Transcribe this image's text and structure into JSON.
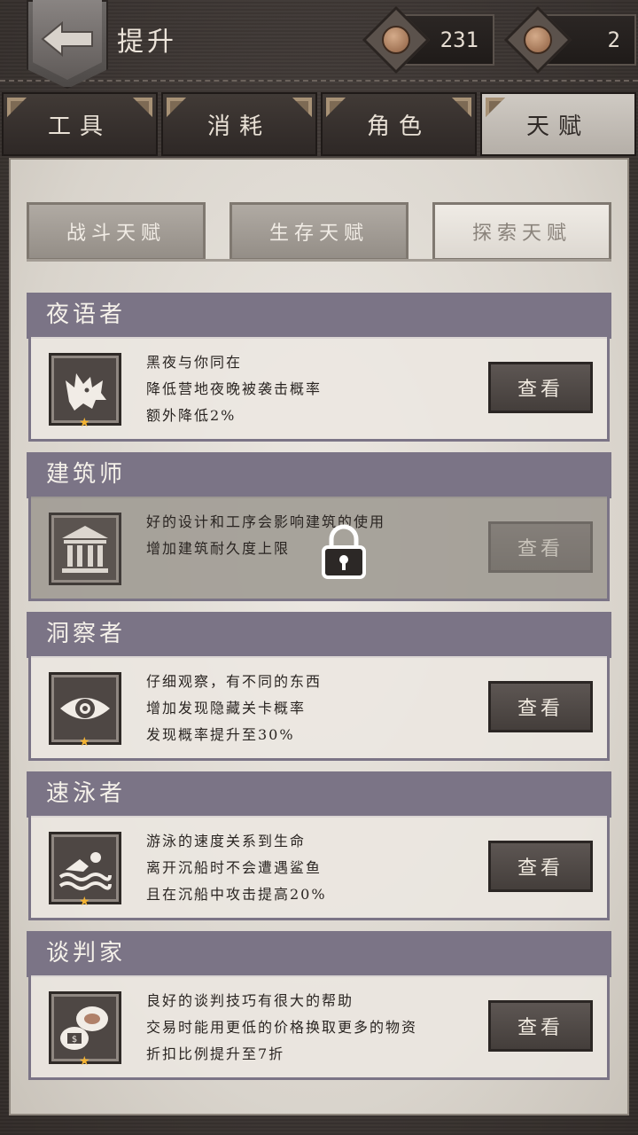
{
  "header": {
    "title": "提升",
    "currency": [
      {
        "icon": "coin-icon",
        "value": "231"
      },
      {
        "icon": "coin-icon",
        "value": "2"
      }
    ]
  },
  "tabs": [
    {
      "label": "工具",
      "active": false
    },
    {
      "label": "消耗",
      "active": false
    },
    {
      "label": "角色",
      "active": false
    },
    {
      "label": "天赋",
      "active": true
    }
  ],
  "subtabs": [
    {
      "label": "战斗天赋",
      "active": false
    },
    {
      "label": "生存天赋",
      "active": false
    },
    {
      "label": "探索天赋",
      "active": true
    }
  ],
  "talents": [
    {
      "name": "夜语者",
      "icon": "wolf-icon",
      "lines": [
        "黑夜与你同在",
        "降低营地夜晚被袭击概率",
        "额外降低2%"
      ],
      "stars": 1,
      "locked": false,
      "button": "查看"
    },
    {
      "name": "建筑师",
      "icon": "building-icon",
      "lines": [
        "好的设计和工序会影响建筑的使用",
        "增加建筑耐久度上限"
      ],
      "stars": 0,
      "locked": true,
      "button": "查看"
    },
    {
      "name": "洞察者",
      "icon": "eye-icon",
      "lines": [
        "仔细观察，有不同的东西",
        "增加发现隐藏关卡概率",
        "发现概率提升至30%"
      ],
      "stars": 1,
      "locked": false,
      "button": "查看"
    },
    {
      "name": "速泳者",
      "icon": "swimmer-icon",
      "lines": [
        "游泳的速度关系到生命",
        "离开沉船时不会遭遇鲨鱼",
        "且在沉船中攻击提高20%"
      ],
      "stars": 1,
      "locked": false,
      "button": "查看"
    },
    {
      "name": "谈判家",
      "icon": "trade-icon",
      "lines": [
        "良好的谈判技巧有很大的帮助",
        "交易时能用更低的价格换取更多的物资",
        "折扣比例提升至7折"
      ],
      "stars": 1,
      "locked": false,
      "button": "查看"
    }
  ]
}
